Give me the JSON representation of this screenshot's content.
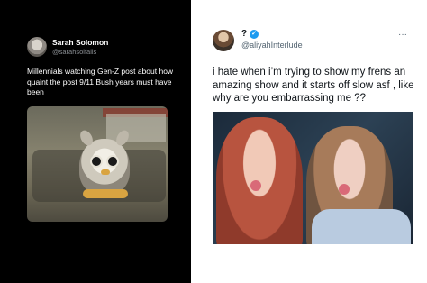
{
  "left_tweet": {
    "name": "Sarah Solomon",
    "handle": "@sarahsolfails",
    "more": "···",
    "text": "Millennials watching Gen-Z post about how quaint the post 9/11 Bush years must have been",
    "colors": {
      "background": "#000000",
      "text": "#ffffff",
      "muted": "#8b8f94"
    }
  },
  "right_tweet": {
    "name": "?",
    "verified_icon": "verified-badge-icon",
    "handle": "@aliyahInterlude",
    "more": "···",
    "text": "i hate when i’m trying to show my frens an amazing show and it starts off slow asf , like why are you embarrassing me ??",
    "colors": {
      "background": "#ffffff",
      "text": "#0f1419",
      "muted": "#536471",
      "accent": "#1d9bf0"
    }
  }
}
